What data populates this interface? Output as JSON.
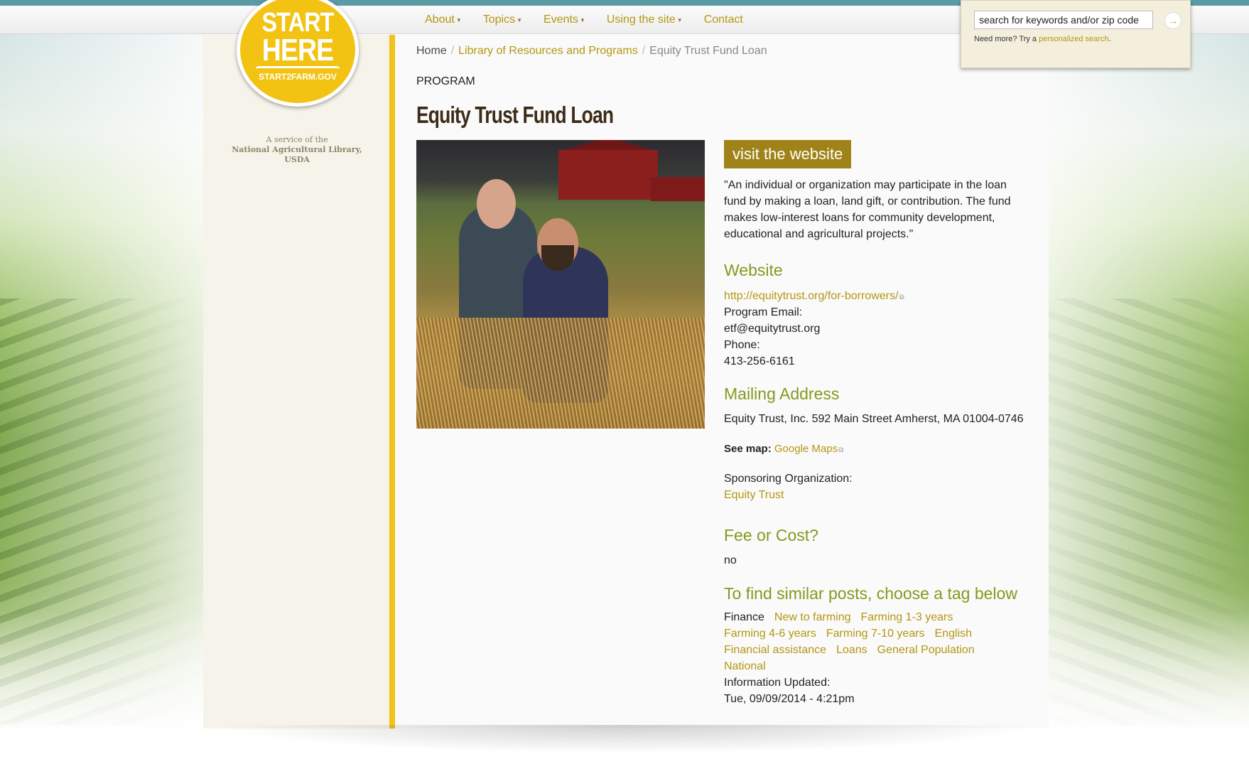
{
  "nav": {
    "items": [
      {
        "label": "About",
        "dropdown": true
      },
      {
        "label": "Topics",
        "dropdown": true
      },
      {
        "label": "Events",
        "dropdown": true
      },
      {
        "label": "Using the site",
        "dropdown": true
      },
      {
        "label": "Contact",
        "dropdown": false
      }
    ]
  },
  "logo": {
    "line1": "START",
    "line2": "HERE",
    "url": "START2FARM.GOV"
  },
  "sidebar": {
    "service_line1": "A service of the",
    "service_line2": "National Agricultural Library,",
    "service_line3": "USDA"
  },
  "search": {
    "value": "search for keywords and/or zip code",
    "go_icon": "arrow-right-icon",
    "more_text": "Need more? Try a",
    "more_link": "personalized search",
    "more_end": "."
  },
  "breadcrumb": {
    "home": "Home",
    "library": "Library of Resources and Programs",
    "current": "Equity Trust Fund Loan"
  },
  "page": {
    "type": "PROGRAM",
    "title": "Equity Trust Fund Loan",
    "visit_button": "visit the website",
    "quote": "\"An individual or organization may participate in the loan fund by making a loan, land gift, or contribution.  The fund makes low-interest loans for community development, educational and agricultural projects.\"",
    "website_heading": "Website",
    "website_url": "http://equitytrust.org/for-borrowers/",
    "email_label": "Program Email:",
    "email": "etf@equitytrust.org",
    "phone_label": "Phone:",
    "phone": "413-256-6161",
    "mailing_heading": "Mailing Address",
    "address": "Equity Trust, Inc. 592 Main Street Amherst, MA 01004-0746",
    "see_map_label": "See map:",
    "map_link": "Google Maps",
    "sponsor_label": "Sponsoring Organization:",
    "sponsor": "Equity Trust",
    "fee_heading": "Fee or Cost?",
    "fee": "no",
    "tags_heading": "To find similar posts, choose a tag below",
    "tags": [
      {
        "label": "Finance",
        "link": false
      },
      {
        "label": "New to farming",
        "link": true
      },
      {
        "label": "Farming 1-3 years",
        "link": true
      },
      {
        "label": "Farming 4-6 years",
        "link": true
      },
      {
        "label": "Farming 7-10 years",
        "link": true
      },
      {
        "label": "English",
        "link": true
      },
      {
        "label": "Financial assistance",
        "link": true
      },
      {
        "label": "Loans",
        "link": true
      },
      {
        "label": "General Population",
        "link": true
      },
      {
        "label": "National",
        "link": true
      }
    ],
    "updated_label": "Information Updated:",
    "updated": "Tue, 09/09/2014 - 4:21pm"
  },
  "colors": {
    "accent": "#b59612",
    "heading_green": "#829b1c",
    "visit_button": "#a08318",
    "sidebar_bar": "#f0c21a",
    "top_stripe": "#5b9ba6"
  }
}
